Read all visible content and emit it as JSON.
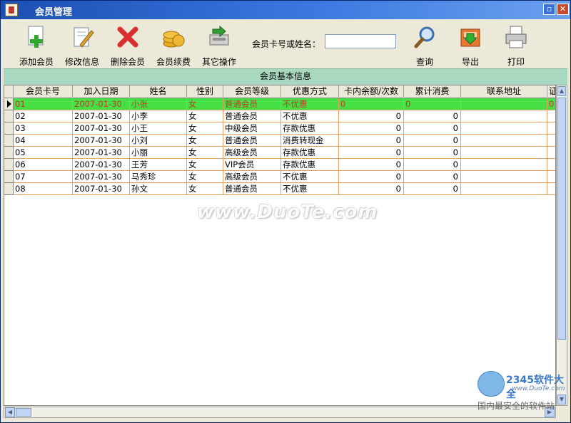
{
  "window": {
    "title": "会员管理"
  },
  "toolbar": {
    "buttons": [
      {
        "label": "添加会员",
        "icon": "add-member-icon"
      },
      {
        "label": "修改信息",
        "icon": "edit-info-icon"
      },
      {
        "label": "删除会员",
        "icon": "delete-member-icon"
      },
      {
        "label": "会员续费",
        "icon": "renew-coins-icon"
      },
      {
        "label": "其它操作",
        "icon": "other-operations-icon"
      },
      {
        "label": "查询",
        "icon": "search-magnifier-icon"
      },
      {
        "label": "导出",
        "icon": "export-icon"
      },
      {
        "label": "打印",
        "icon": "printer-icon"
      }
    ],
    "search_label": "会员卡号或姓名：",
    "search_value": ""
  },
  "section": {
    "title": "会员基本信息"
  },
  "grid": {
    "columns": [
      "会员卡号",
      "加入日期",
      "姓名",
      "性别",
      "会员等级",
      "优惠方式",
      "卡内余额/次数",
      "累计消费",
      "联系地址",
      "证"
    ],
    "rows": [
      {
        "id": "01",
        "date": "2007-01-30",
        "name": "小张",
        "gender": "女",
        "level": "普通会员",
        "discount": "不优惠",
        "balance": "0",
        "total": "0",
        "address": "",
        "extra": "0"
      },
      {
        "id": "02",
        "date": "2007-01-30",
        "name": "小李",
        "gender": "女",
        "level": "普通会员",
        "discount": "不优惠",
        "balance": "0",
        "total": "0",
        "address": "",
        "extra": ""
      },
      {
        "id": "03",
        "date": "2007-01-30",
        "name": "小王",
        "gender": "女",
        "level": "中级会员",
        "discount": "存款优惠",
        "balance": "0",
        "total": "0",
        "address": "",
        "extra": ""
      },
      {
        "id": "04",
        "date": "2007-01-30",
        "name": "小刘",
        "gender": "女",
        "level": "普通会员",
        "discount": "消费转现金",
        "balance": "0",
        "total": "0",
        "address": "",
        "extra": ""
      },
      {
        "id": "05",
        "date": "2007-01-30",
        "name": "小丽",
        "gender": "女",
        "level": "高级会员",
        "discount": "存款优惠",
        "balance": "0",
        "total": "0",
        "address": "",
        "extra": ""
      },
      {
        "id": "06",
        "date": "2007-01-30",
        "name": "王芳",
        "gender": "女",
        "level": "VIP会员",
        "discount": "存款优惠",
        "balance": "0",
        "total": "0",
        "address": "",
        "extra": ""
      },
      {
        "id": "07",
        "date": "2007-01-30",
        "name": "马秀珍",
        "gender": "女",
        "level": "高级会员",
        "discount": "不优惠",
        "balance": "0",
        "total": "0",
        "address": "",
        "extra": ""
      },
      {
        "id": "08",
        "date": "2007-01-30",
        "name": "孙文",
        "gender": "女",
        "level": "普通会员",
        "discount": "不优惠",
        "balance": "0",
        "total": "0",
        "address": "",
        "extra": ""
      }
    ],
    "selected_index": 0
  },
  "watermarks": {
    "main": "www.DuoTe.com",
    "brand": "2345软件大全",
    "brand_url": "www.DuoTe.com",
    "slogan": "国内最安全的软件站"
  },
  "colors": {
    "selected_row": "#46e046",
    "selected_text": "#c0392b",
    "band": "#a8d8c0",
    "grid_line": "#e8a060"
  }
}
